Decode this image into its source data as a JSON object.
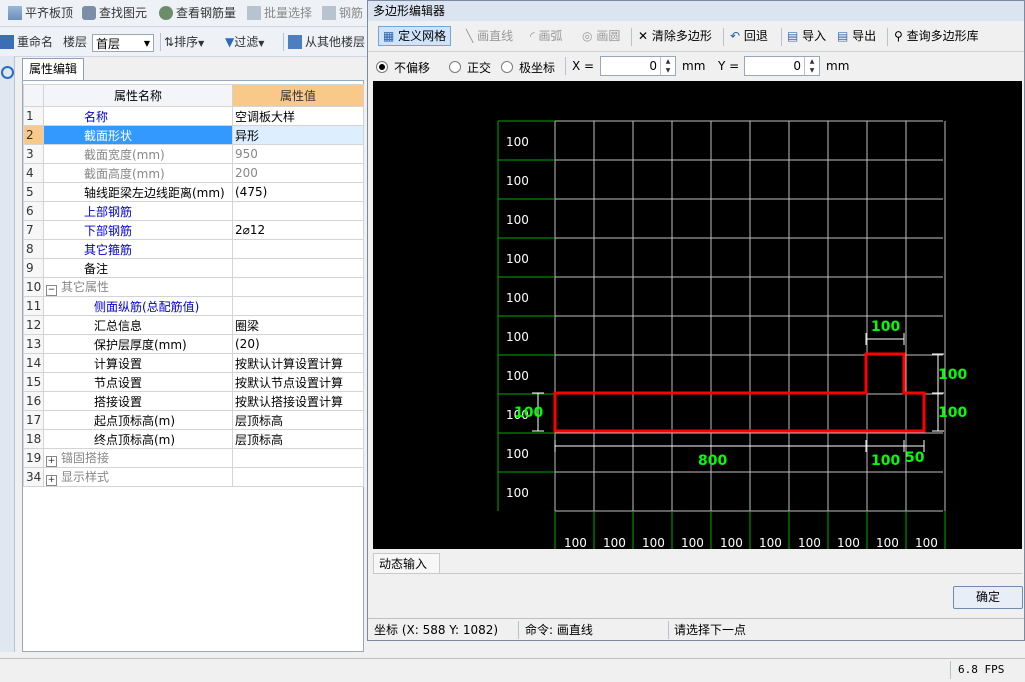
{
  "toolbar1": {
    "items": [
      "平齐板顶",
      "查找图元",
      "查看钢筋量",
      "批量选择",
      "钢筋"
    ]
  },
  "toolbar2": {
    "rename": "重命名",
    "floor_label": "楼层",
    "floor_value": "首层",
    "sort": "排序",
    "filter": "过滤",
    "copy_from": "从其他楼层"
  },
  "panel": {
    "tab": "属性编辑",
    "col_name": "属性名称",
    "col_value": "属性值",
    "rows": [
      {
        "n": "1",
        "name": "名称",
        "value": "空调板大样"
      },
      {
        "n": "2",
        "name": "截面形状",
        "value": "异形"
      },
      {
        "n": "3",
        "name": "截面宽度(mm)",
        "value": "950"
      },
      {
        "n": "4",
        "name": "截面高度(mm)",
        "value": "200"
      },
      {
        "n": "5",
        "name": "轴线距梁左边线距离(mm)",
        "value": "(475)"
      },
      {
        "n": "6",
        "name": "上部钢筋",
        "value": ""
      },
      {
        "n": "7",
        "name": "下部钢筋",
        "value": "2⌀12"
      },
      {
        "n": "8",
        "name": "其它箍筋",
        "value": ""
      },
      {
        "n": "9",
        "name": "备注",
        "value": ""
      },
      {
        "n": "10",
        "name": "其它属性",
        "value": ""
      },
      {
        "n": "11",
        "name": "侧面纵筋(总配筋值)",
        "value": ""
      },
      {
        "n": "12",
        "name": "汇总信息",
        "value": "圈梁"
      },
      {
        "n": "13",
        "name": "保护层厚度(mm)",
        "value": "(20)"
      },
      {
        "n": "14",
        "name": "计算设置",
        "value": "按默认计算设置计算"
      },
      {
        "n": "15",
        "name": "节点设置",
        "value": "按默认节点设置计算"
      },
      {
        "n": "16",
        "name": "搭接设置",
        "value": "按默认搭接设置计算"
      },
      {
        "n": "17",
        "name": "起点顶标高(m)",
        "value": "层顶标高"
      },
      {
        "n": "18",
        "name": "终点顶标高(m)",
        "value": "层顶标高"
      },
      {
        "n": "19",
        "name": "锚固搭接",
        "value": ""
      },
      {
        "n": "34",
        "name": "显示样式",
        "value": ""
      }
    ]
  },
  "dialog": {
    "title": "多边形编辑器",
    "tools": {
      "grid": "定义网格",
      "line": "画直线",
      "arc": "画弧",
      "circle": "画圆",
      "clear": "清除多边形",
      "undo": "回退",
      "import": "导入",
      "export": "导出",
      "library": "查询多边形库"
    },
    "modes": {
      "none": "不偏移",
      "ortho": "正交",
      "polar": "极坐标"
    },
    "x_label": "X =",
    "x_value": "0",
    "y_label": "Y =",
    "y_value": "0",
    "unit": "mm",
    "grid": {
      "row_labels": [
        "100",
        "100",
        "100",
        "100",
        "100",
        "100",
        "100",
        "100",
        "100",
        "100"
      ],
      "col_labels": [
        "100",
        "100",
        "100",
        "100",
        "100",
        "100",
        "100",
        "100",
        "100",
        "100"
      ]
    },
    "dims": {
      "top": "100",
      "right_upper": "100",
      "right_lower": "100",
      "left": "100",
      "bottom_total": "800",
      "bottom_mid": "100",
      "bottom_right": "50"
    },
    "dynamic_tab": "动态输入",
    "ok": "确定",
    "status": {
      "coord": "坐标 (X: 588 Y: 1082)",
      "command": "命令: 画直线",
      "prompt": "请选择下一点"
    }
  },
  "main_status": {
    "fps": "6.8 FPS"
  },
  "colors": {
    "canvas_bg": "#000000",
    "grid_line": "#c0c0c0",
    "polygon": "#ff0000",
    "dim_text": "#00ff00"
  }
}
